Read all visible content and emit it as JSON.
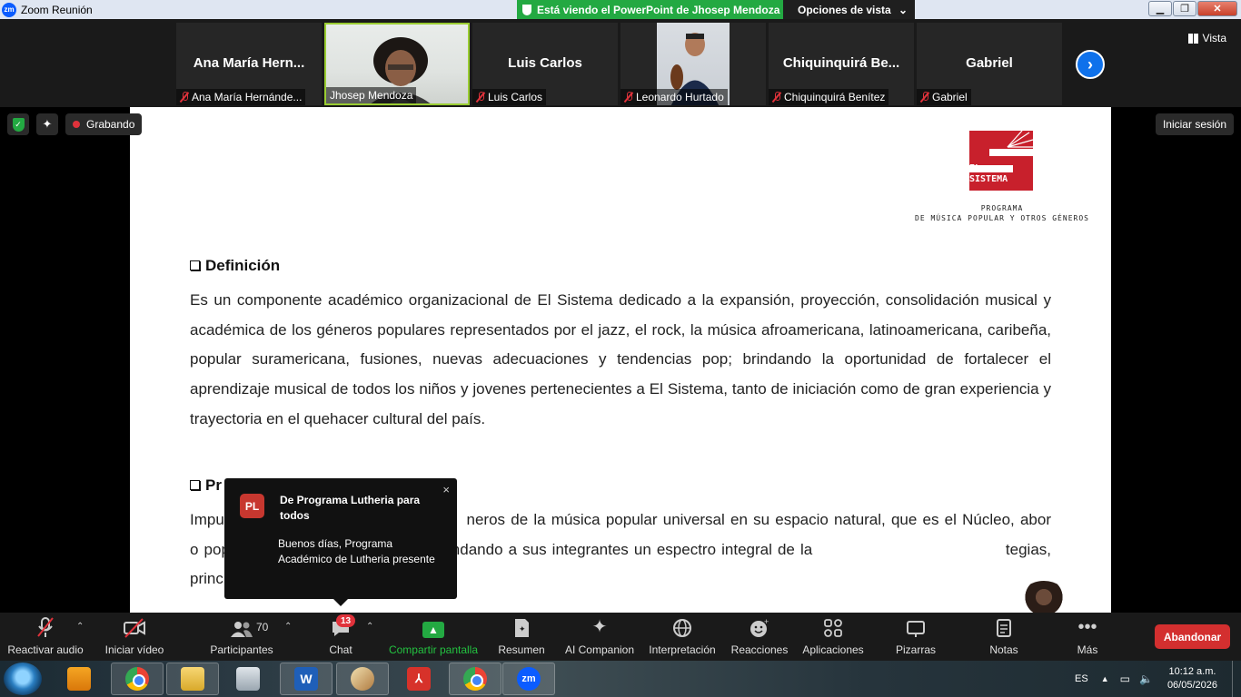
{
  "titlebar": {
    "app_title": "Zoom Reunión",
    "viewing_banner": "Está viendo el PowerPoint de Jhosep Mendoza",
    "view_options": "Opciones de vista",
    "caret": "⌄",
    "logo": "zm"
  },
  "gallery": {
    "vista_label": "Vista",
    "participants": [
      {
        "big_name": "Ana María  Hern...",
        "label": "Ana María Hernánde...",
        "video": false
      },
      {
        "big_name": "",
        "label": "Jhosep Mendoza",
        "video": true
      },
      {
        "big_name": "Luis Carlos",
        "label": "Luis Carlos",
        "video": false
      },
      {
        "big_name": "",
        "label": "Leonardo Hurtado",
        "video": true
      },
      {
        "big_name": "Chiquinquirá  Be...",
        "label": "Chiquinquirá Benítez",
        "video": false
      },
      {
        "big_name": "Gabriel",
        "label": "Gabriel",
        "video": false
      }
    ],
    "next_arrow": "›"
  },
  "share": {
    "recording_label": "Grabando",
    "signin_label": "Iniciar sesión",
    "slide": {
      "logo_line1": "EL",
      "logo_line2": "SISTEMA",
      "logo_sub1": "PROGRAMA",
      "logo_sub2": "DE MÚSICA POPULAR Y OTROS GÉNEROS",
      "heading1": "Definición",
      "para1": "Es un componente académico organizacional de El Sistema dedicado a la expansión, proyección, consolidación musical y académica de los géneros populares representados por el jazz, el rock, la música afroamericana, latinoamericana, caribeña, popular suramericana, fusiones, nuevas adecuaciones y tendencias pop; brindando la oportunidad de fortalecer el aprendizaje musical de todos los niños y jovenes pertenecientes a El Sistema, tanto de iniciación como de gran experiencia y trayectoria en el quehacer cultural del país.",
      "heading2": "Pr",
      "para2": "Impu                                           neros de la música popular universal en su espacio natural, que es el Núcleo, abor                                            o popular universal y world music, brindando a sus integrantes un espectro integral de la                                   tegias, principios y valores de El Sistema."
    },
    "notification": {
      "avatar": "PL",
      "from": "De Programa Lutheria  para todos",
      "message": "Buenos días, Programa Académico de Lutheria presente",
      "close": "×"
    }
  },
  "toolbar": {
    "unmute": "Reactivar audio",
    "start_video": "Iniciar vídeo",
    "participants": "Participantes",
    "participants_count": "70",
    "chat": "Chat",
    "chat_badge": "13",
    "share": "Compartir pantalla",
    "summary": "Resumen",
    "ai": "AI Companion",
    "interpretation": "Interpretación",
    "reactions": "Reacciones",
    "apps": "Aplicaciones",
    "whiteboards": "Pizarras",
    "notes": "Notas",
    "more": "Más",
    "leave": "Abandonar"
  },
  "taskbar": {
    "lang": "ES",
    "time": "10:12 a.m.",
    "date": "06/05/2026",
    "word_letter": "W",
    "zoom_letter": "zm"
  }
}
